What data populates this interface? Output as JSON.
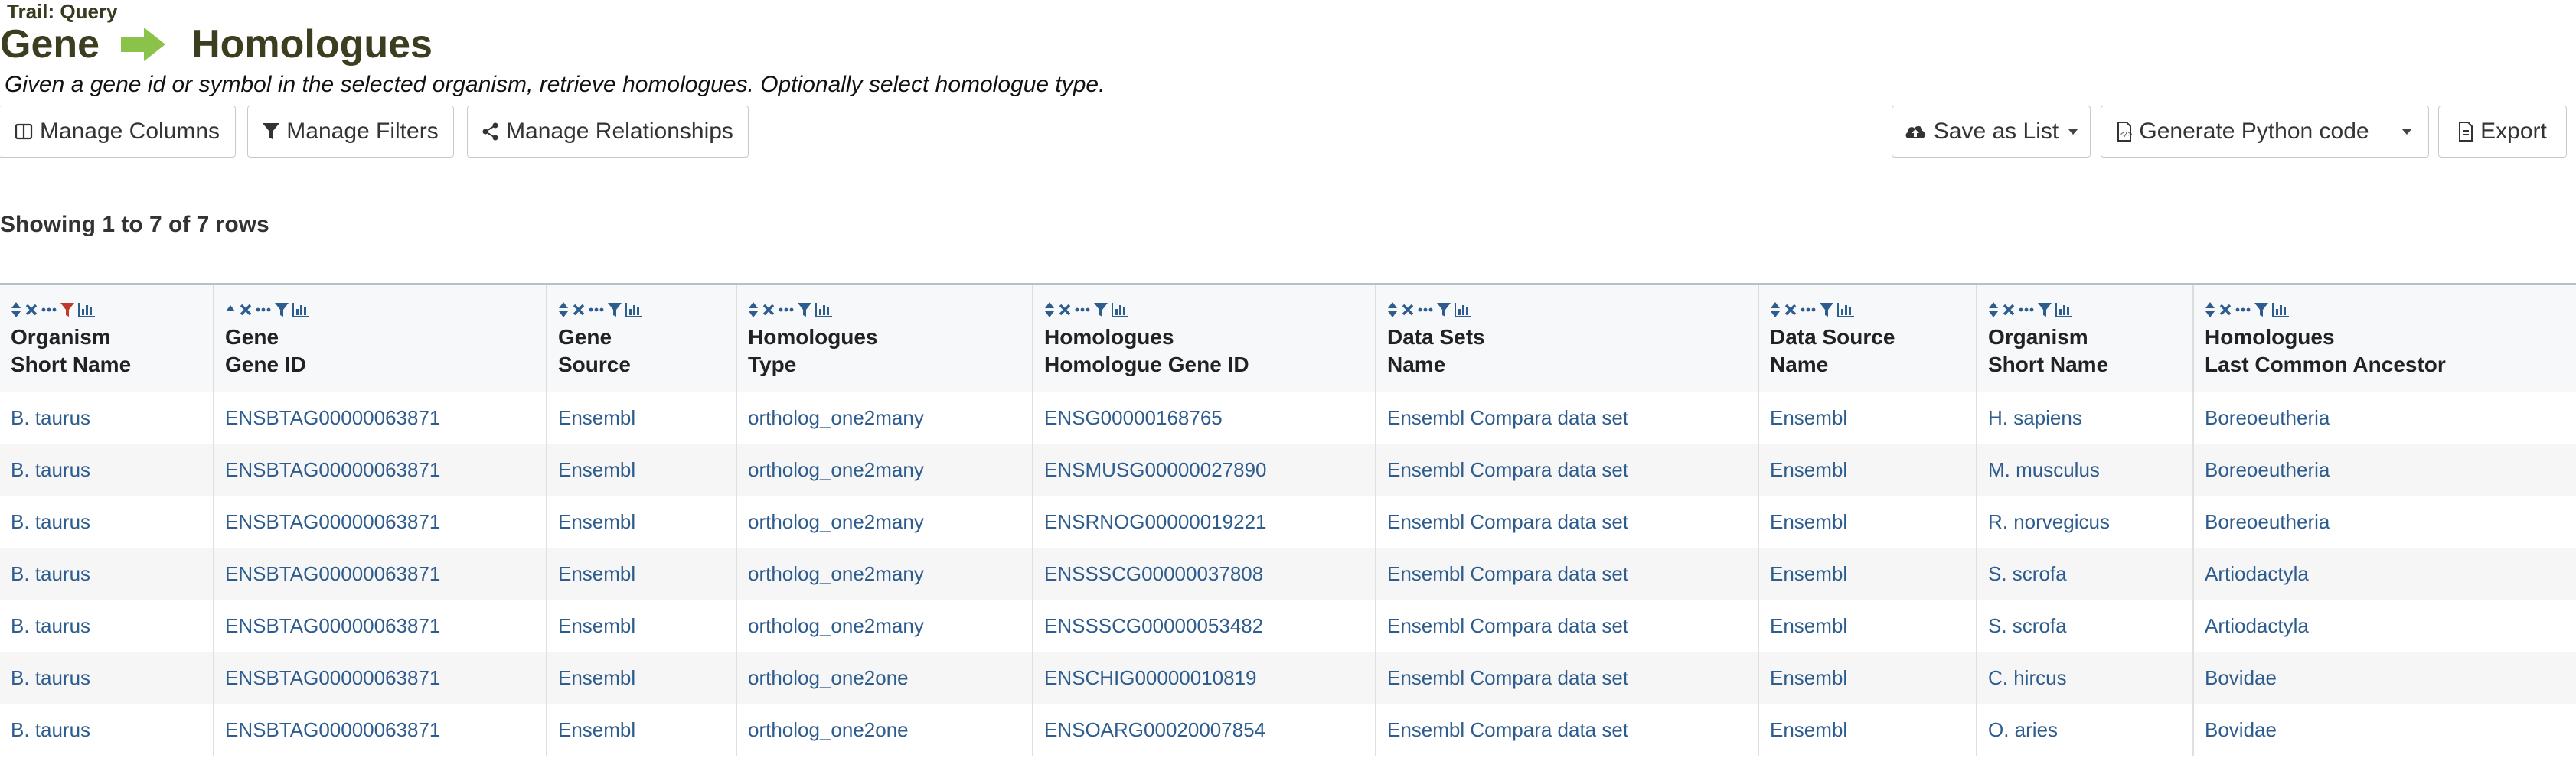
{
  "trail": "Trail: Query",
  "header": {
    "left": "Gene",
    "right": "Homologues",
    "description": "Given a gene id or symbol in the selected organism, retrieve homologues. Optionally select homologue type."
  },
  "toolbar": {
    "manage_columns": "Manage Columns",
    "manage_filters": "Manage Filters",
    "manage_relationships": "Manage Relationships",
    "save_as_list": "Save as List",
    "generate_code": "Generate Python code",
    "export": "Export"
  },
  "showing": "Showing 1 to 7 of 7 rows",
  "columns": [
    {
      "line1": "Organism",
      "line2": "Short Name"
    },
    {
      "line1": "Gene",
      "line2": "Gene ID"
    },
    {
      "line1": "Gene",
      "line2": "Source"
    },
    {
      "line1": "Homologues",
      "line2": "Type"
    },
    {
      "line1": "Homologues",
      "line2": "Homologue Gene ID"
    },
    {
      "line1": "Data Sets",
      "line2": "Name"
    },
    {
      "line1": "Data Source",
      "line2": "Name"
    },
    {
      "line1": "Organism",
      "line2": "Short Name"
    },
    {
      "line1": "Homologues",
      "line2": "Last Common Ancestor"
    }
  ],
  "rows": [
    [
      "B. taurus",
      "ENSBTAG00000063871",
      "Ensembl",
      "ortholog_one2many",
      "ENSG00000168765",
      "Ensembl Compara data set",
      "Ensembl",
      "H. sapiens",
      "Boreoeutheria"
    ],
    [
      "B. taurus",
      "ENSBTAG00000063871",
      "Ensembl",
      "ortholog_one2many",
      "ENSMUSG00000027890",
      "Ensembl Compara data set",
      "Ensembl",
      "M. musculus",
      "Boreoeutheria"
    ],
    [
      "B. taurus",
      "ENSBTAG00000063871",
      "Ensembl",
      "ortholog_one2many",
      "ENSRNOG00000019221",
      "Ensembl Compara data set",
      "Ensembl",
      "R. norvegicus",
      "Boreoeutheria"
    ],
    [
      "B. taurus",
      "ENSBTAG00000063871",
      "Ensembl",
      "ortholog_one2many",
      "ENSSSCG00000037808",
      "Ensembl Compara data set",
      "Ensembl",
      "S. scrofa",
      "Artiodactyla"
    ],
    [
      "B. taurus",
      "ENSBTAG00000063871",
      "Ensembl",
      "ortholog_one2many",
      "ENSSSCG00000053482",
      "Ensembl Compara data set",
      "Ensembl",
      "S. scrofa",
      "Artiodactyla"
    ],
    [
      "B. taurus",
      "ENSBTAG00000063871",
      "Ensembl",
      "ortholog_one2one",
      "ENSCHIG00000010819",
      "Ensembl Compara data set",
      "Ensembl",
      "C. hircus",
      "Bovidae"
    ],
    [
      "B. taurus",
      "ENSBTAG00000063871",
      "Ensembl",
      "ortholog_one2one",
      "ENSOARG00020007854",
      "Ensembl Compara data set",
      "Ensembl",
      "O. aries",
      "Bovidae"
    ]
  ],
  "colors": {
    "link": "#2d5c8e",
    "active_filter": "#c0392b",
    "arrow": "#8bc34a",
    "title": "#3d3d1f"
  }
}
